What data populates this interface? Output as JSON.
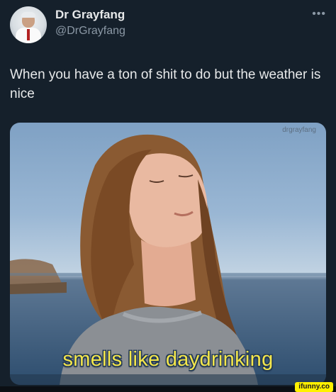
{
  "author": {
    "display_name": "Dr Grayfang",
    "handle": "@DrGrayfang",
    "more_icon": "•••"
  },
  "tweet": {
    "text": "When you have a ton of shit to do but the weather is nice"
  },
  "media": {
    "watermark": "drgrayfang",
    "caption": "smells like daydrinking",
    "caption_color": "#f4e64b"
  },
  "footer": {
    "site_badge": "ifunny.co",
    "badge_color": "#fff100"
  },
  "colors": {
    "background": "#15202b",
    "handle": "#8b98a5",
    "text": "#e7e9ea"
  }
}
